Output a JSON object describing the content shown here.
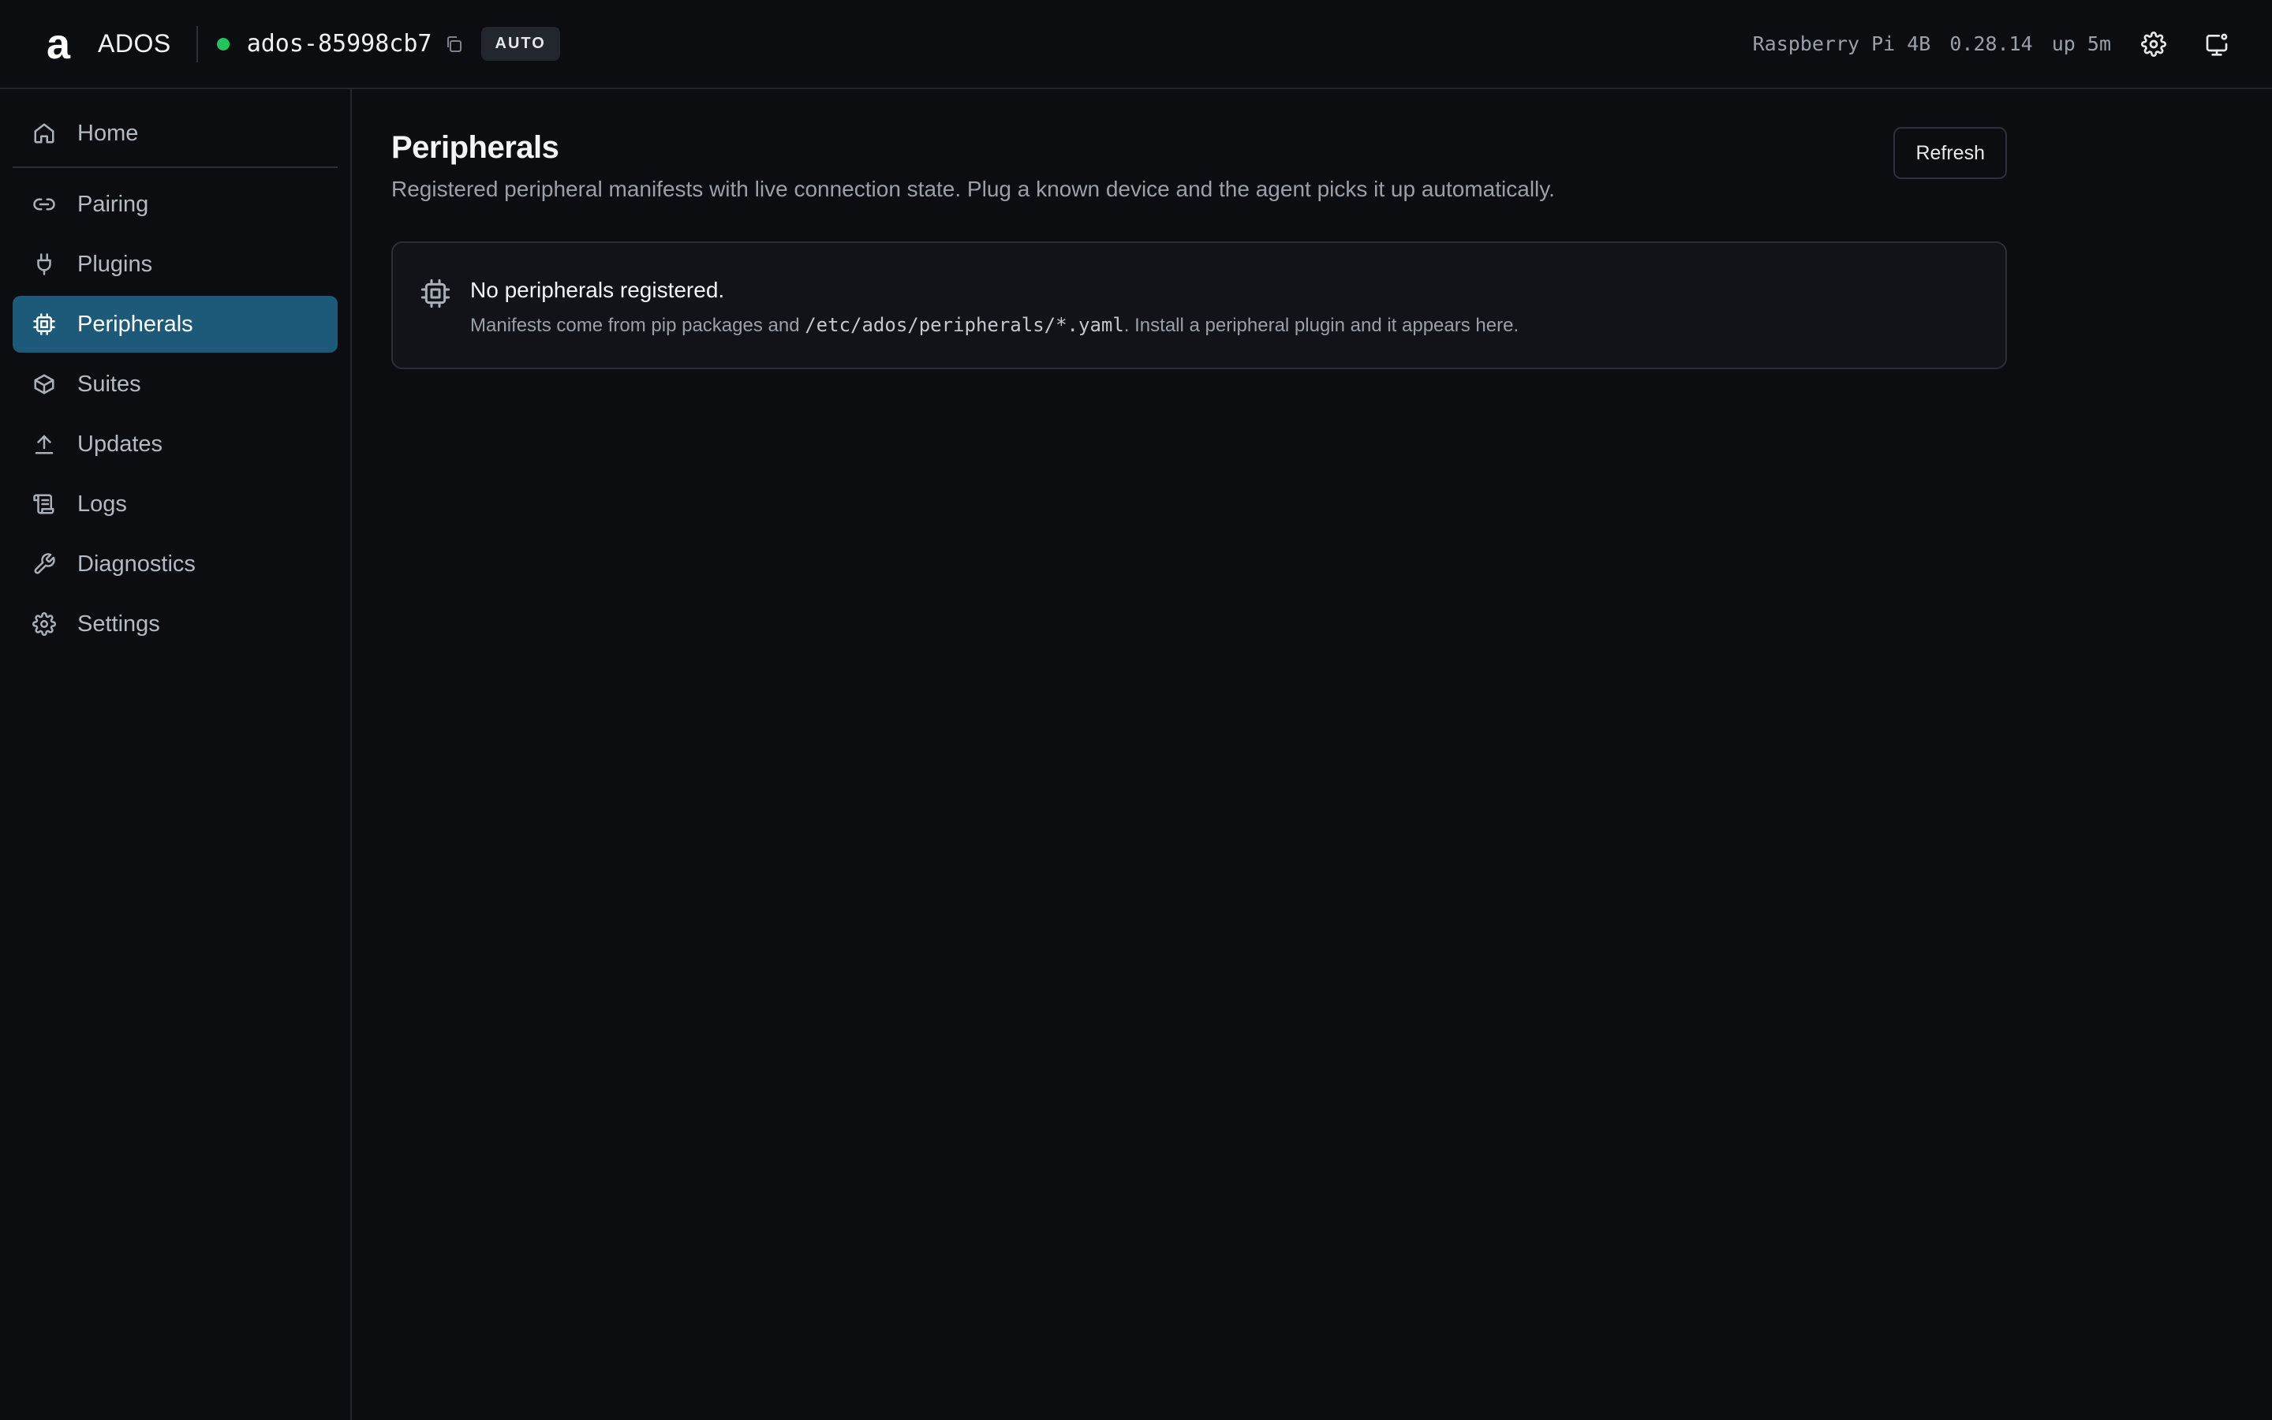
{
  "topbar": {
    "logo_glyph": "a",
    "brand": "ADOS",
    "hostname": "ados-85998cb7",
    "mode_badge": "AUTO",
    "status_color": "#22c55e",
    "device_model": "Raspberry Pi 4B",
    "version": "0.28.14",
    "uptime": "up 5m",
    "icons": [
      "copy-icon",
      "gear-icon",
      "monitor-icon"
    ]
  },
  "sidebar": {
    "items": [
      {
        "label": "Home",
        "icon": "home-icon"
      },
      {
        "label": "Pairing",
        "icon": "link-icon"
      },
      {
        "label": "Plugins",
        "icon": "plug-icon"
      },
      {
        "label": "Peripherals",
        "icon": "chip-icon",
        "active": true
      },
      {
        "label": "Suites",
        "icon": "box-icon"
      },
      {
        "label": "Updates",
        "icon": "upload-icon"
      },
      {
        "label": "Logs",
        "icon": "scroll-icon"
      },
      {
        "label": "Diagnostics",
        "icon": "wrench-icon"
      },
      {
        "label": "Settings",
        "icon": "gear-icon"
      }
    ],
    "active_color": "#1d5a7a"
  },
  "main": {
    "title": "Peripherals",
    "description": "Registered peripheral manifests with live connection state. Plug a known device and the agent picks it up automatically.",
    "refresh_label": "Refresh",
    "empty": {
      "title": "No peripherals registered.",
      "desc_prefix": "Manifests come from pip packages and ",
      "desc_path": "/etc/ados/peripherals/*.yaml",
      "desc_suffix": ". Install a peripheral plugin and it appears here."
    }
  }
}
